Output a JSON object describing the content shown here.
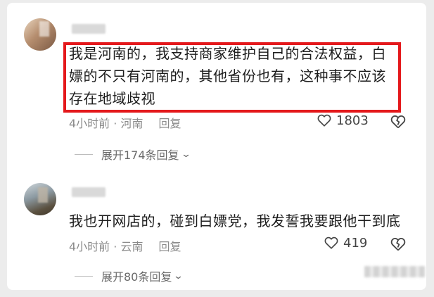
{
  "comments": [
    {
      "text": "我是河南的，我支持商家维护自己的合法权益，白嫖的不只有河南的，其他省份也有，这种事不应该存在地域歧视",
      "time": "4小时前",
      "location": "河南",
      "reply_label": "回复",
      "likes": "1803",
      "expand_label": "展开174条回复"
    },
    {
      "text": "我也开网店的，碰到白嫖党，我发誓我要跟他干到底",
      "time": "4小时前",
      "location": "云南",
      "reply_label": "回复",
      "likes": "419",
      "expand_label": "展开80条回复"
    }
  ],
  "icons": {
    "like": "heart-icon",
    "dislike": "broken-heart-icon",
    "expand": "chevron-down-icon"
  },
  "colors": {
    "highlight": "#e4191c",
    "meta_text": "#8a8a8a",
    "body_text": "#1c1c1c"
  }
}
